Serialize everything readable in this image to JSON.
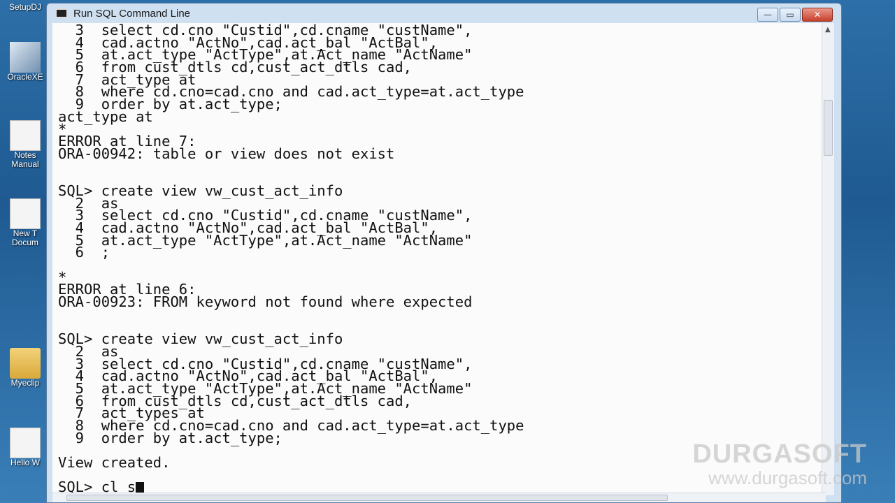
{
  "desktop": {
    "icons": [
      {
        "label": "SetupDJ",
        "icon": "setup-icon"
      },
      {
        "label": "OracleXE",
        "icon": "oracle-icon"
      },
      {
        "label": "Notes",
        "icon": "notes-icon"
      },
      {
        "label": "Manual",
        "icon": "document-icon"
      },
      {
        "label": "New T",
        "icon": "document-icon"
      },
      {
        "label": "Docum",
        "icon": "document-icon"
      },
      {
        "label": "Myeclip",
        "icon": "folder-icon"
      },
      {
        "label": "Hello W",
        "icon": "document-icon"
      }
    ]
  },
  "window": {
    "title": "Run SQL Command Line",
    "buttons": {
      "minimize": "—",
      "maximize": "▭",
      "close": "✕"
    }
  },
  "console": {
    "lines": [
      "  3  select cd.cno \"Custid\",cd.cname \"custName\",",
      "  4  cad.actno \"ActNo\",cad.act_bal \"ActBal\",",
      "  5  at.act_type \"ActType\",at.Act_name \"ActName\"",
      "  6  from cust_dtls cd,cust_act_dtls cad,",
      "  7  act_type at",
      "  8  where cd.cno=cad.cno and cad.act_type=at.act_type",
      "  9  order by at.act_type;",
      "act_type at",
      "*",
      "ERROR at line 7:",
      "ORA-00942: table or view does not exist",
      "",
      "",
      "SQL> create view vw_cust_act_info",
      "  2  as",
      "  3  select cd.cno \"Custid\",cd.cname \"custName\",",
      "  4  cad.actno \"ActNo\",cad.act_bal \"ActBal\",",
      "  5  at.act_type \"ActType\",at.Act_name \"ActName\"",
      "  6  ;",
      "",
      "*",
      "ERROR at line 6:",
      "ORA-00923: FROM keyword not found where expected",
      "",
      "",
      "SQL> create view vw_cust_act_info",
      "  2  as",
      "  3  select cd.cno \"Custid\",cd.cname \"custName\",",
      "  4  cad.actno \"ActNo\",cad.act_bal \"ActBal\",",
      "  5  at.act_type \"ActType\",at.Act_name \"ActName\"",
      "  6  from cust_dtls cd,cust_act_dtls cad,",
      "  7  act_types at",
      "  8  where cd.cno=cad.cno and cad.act_type=at.act_type",
      "  9  order by at.act_type;",
      "",
      "View created.",
      "",
      "SQL> cl s"
    ]
  },
  "watermark": {
    "title": "DURGASOFT",
    "url": "www.durgasoft.com"
  }
}
